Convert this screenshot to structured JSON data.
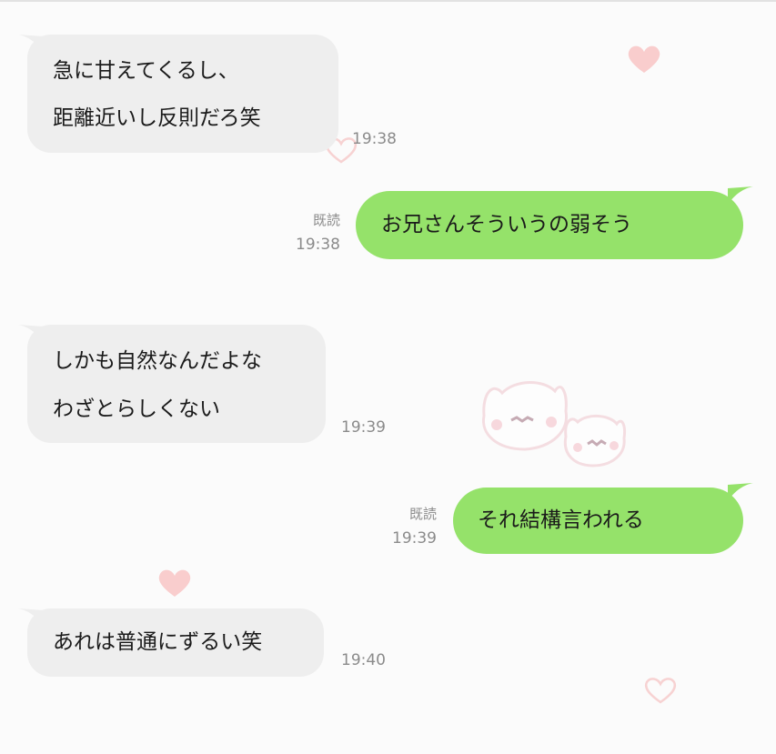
{
  "messages": [
    {
      "lines": [
        "急に甘えてくるし、",
        "距離近いし反則だろ笑"
      ],
      "time": "19:38"
    },
    {
      "text": "お兄さんそういうの弱そう",
      "read": "既読",
      "time": "19:38"
    },
    {
      "lines": [
        "しかも自然なんだよな",
        "わざとらしくない"
      ],
      "time": "19:39"
    },
    {
      "text": "それ結構言われる",
      "read": "既読",
      "time": "19:39"
    },
    {
      "lines": [
        "あれは普通にずるい笑"
      ],
      "time": "19:40"
    }
  ],
  "colors": {
    "background": "#fbfbfb",
    "incoming_bubble": "#eeeeee",
    "outgoing_bubble": "#95e26a",
    "meta_text": "#8b8b8b",
    "heart": "#f6c4c4"
  },
  "icons": [
    "heart-icon",
    "cat-sticker-icon"
  ]
}
